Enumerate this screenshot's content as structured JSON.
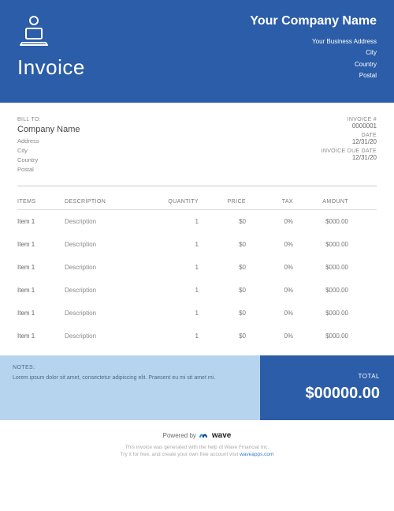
{
  "header": {
    "title": "Invoice",
    "company_name": "Your Company Name",
    "address": "Your Business Address",
    "city": "City",
    "country": "Country",
    "postal": "Postal"
  },
  "bill_to": {
    "label": "BILL TO:",
    "company": "Company Name",
    "address": "Address",
    "city": "City",
    "country": "Country",
    "postal": "Postal"
  },
  "meta": {
    "invoice_num_label": "INVOICE #",
    "invoice_num": "0000001",
    "date_label": "DATE",
    "date": "12/31/20",
    "due_label": "INVOICE DUE DATE",
    "due": "12/31/20"
  },
  "columns": {
    "items": "ITEMS",
    "description": "DESCRIPTION",
    "quantity": "QUANTITY",
    "price": "PRICE",
    "tax": "TAX",
    "amount": "AMOUNT"
  },
  "rows": [
    {
      "item": "Item 1",
      "desc": "Description",
      "qty": "1",
      "price": "$0",
      "tax": "0%",
      "amount": "$000.00"
    },
    {
      "item": "Item 1",
      "desc": "Description",
      "qty": "1",
      "price": "$0",
      "tax": "0%",
      "amount": "$000.00"
    },
    {
      "item": "Item 1",
      "desc": "Description",
      "qty": "1",
      "price": "$0",
      "tax": "0%",
      "amount": "$000.00"
    },
    {
      "item": "Item 1",
      "desc": "Description",
      "qty": "1",
      "price": "$0",
      "tax": "0%",
      "amount": "$000.00"
    },
    {
      "item": "Item 1",
      "desc": "Description",
      "qty": "1",
      "price": "$0",
      "tax": "0%",
      "amount": "$000.00"
    },
    {
      "item": "Item 1",
      "desc": "Description",
      "qty": "1",
      "price": "$0",
      "tax": "0%",
      "amount": "$000.00"
    }
  ],
  "notes": {
    "label": "NOTES:",
    "text": "Lorem ipsum dolor sit amet, consectetur adipiscing elit. Praesent eu mi sit amet mi."
  },
  "total": {
    "label": "TOTAL",
    "value": "$00000.00"
  },
  "powered": {
    "prefix": "Powered by",
    "brand": "wave",
    "line1": "This invoice was generated with the help of Wave Financial Inc.",
    "line2_a": "Try it for free, and create your own free account visit ",
    "link": "waveapps.com"
  }
}
